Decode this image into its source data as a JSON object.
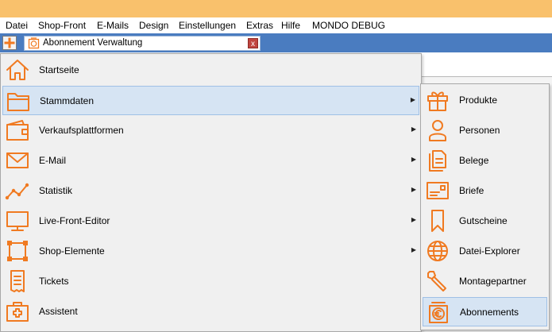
{
  "menubar": {
    "items": [
      "Datei",
      "Shop-Front",
      "E-Mails",
      "Design",
      "Einstellungen",
      "Extras",
      "Hilfe",
      "MONDO DEBUG"
    ]
  },
  "tab": {
    "label": "Abonnement Verwaltung",
    "close": "x"
  },
  "main_menu": {
    "items": [
      {
        "label": "Startseite",
        "icon": "home-icon",
        "submenu": false
      },
      {
        "label": "Stammdaten",
        "icon": "folder-icon",
        "submenu": true,
        "highlighted": true
      },
      {
        "label": "Verkaufsplattformen",
        "icon": "wallet-icon",
        "submenu": true
      },
      {
        "label": "E-Mail",
        "icon": "envelope-icon",
        "submenu": true
      },
      {
        "label": "Statistik",
        "icon": "line-chart-icon",
        "submenu": true
      },
      {
        "label": "Live-Front-Editor",
        "icon": "monitor-icon",
        "submenu": true
      },
      {
        "label": "Shop-Elemente",
        "icon": "selection-icon",
        "submenu": true
      },
      {
        "label": "Tickets",
        "icon": "receipt-icon",
        "submenu": false
      },
      {
        "label": "Assistent",
        "icon": "first-aid-icon",
        "submenu": false
      }
    ]
  },
  "sub_menu": {
    "items": [
      {
        "label": "Produkte",
        "icon": "gift-icon"
      },
      {
        "label": "Personen",
        "icon": "person-icon"
      },
      {
        "label": "Belege",
        "icon": "documents-icon"
      },
      {
        "label": "Briefe",
        "icon": "letter-icon"
      },
      {
        "label": "Gutscheine",
        "icon": "bookmark-icon"
      },
      {
        "label": "Datei-Explorer",
        "icon": "globe-icon"
      },
      {
        "label": "Montagepartner",
        "icon": "wrench-icon"
      },
      {
        "label": "Abonnements",
        "icon": "subscription-icon",
        "highlighted": true
      }
    ]
  },
  "arrow_glyph": "▶",
  "colors": {
    "accent": "#f07a21",
    "titlebar": "#f9c16c",
    "tabbar": "#4a7cc0",
    "highlight": "#d6e4f3"
  }
}
